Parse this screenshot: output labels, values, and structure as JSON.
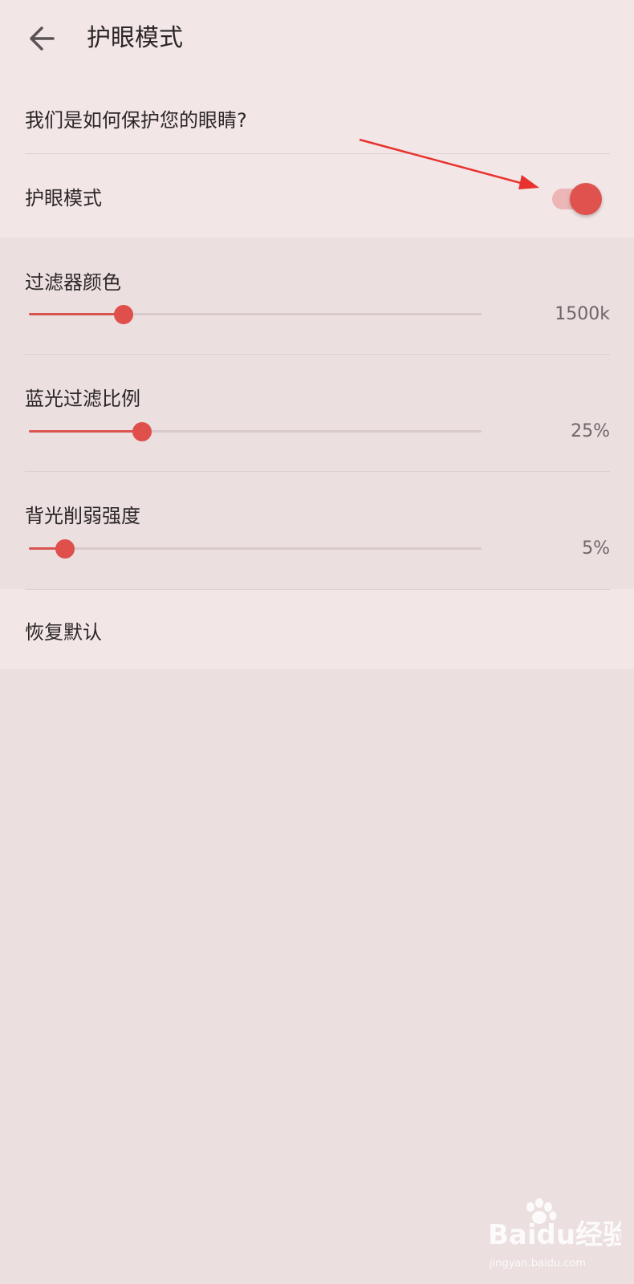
{
  "header": {
    "title": "护眼模式",
    "back_icon": "arrow-left-icon"
  },
  "top": {
    "protect_link": "我们是如何保护您的眼睛?",
    "eye_mode_label": "护眼模式",
    "eye_mode_enabled": true
  },
  "sliders": [
    {
      "label": "过滤器颜色",
      "value_text": "1500k",
      "level": 0.21
    },
    {
      "label": "蓝光过滤比例",
      "value_text": "25%",
      "level": 0.25
    },
    {
      "label": "背光削弱强度",
      "value_text": "5%",
      "level": 0.08
    }
  ],
  "restore": {
    "label": "恢复默认"
  },
  "watermark": {
    "brand": "Baidu经验",
    "url": "jingyan.baidu.com"
  },
  "colors": {
    "accent": "#e0524d",
    "track_on": "#ecb6b6",
    "annotation": "#e8322d",
    "background": "#ebdfe0",
    "surface": "#f3e6e7"
  }
}
